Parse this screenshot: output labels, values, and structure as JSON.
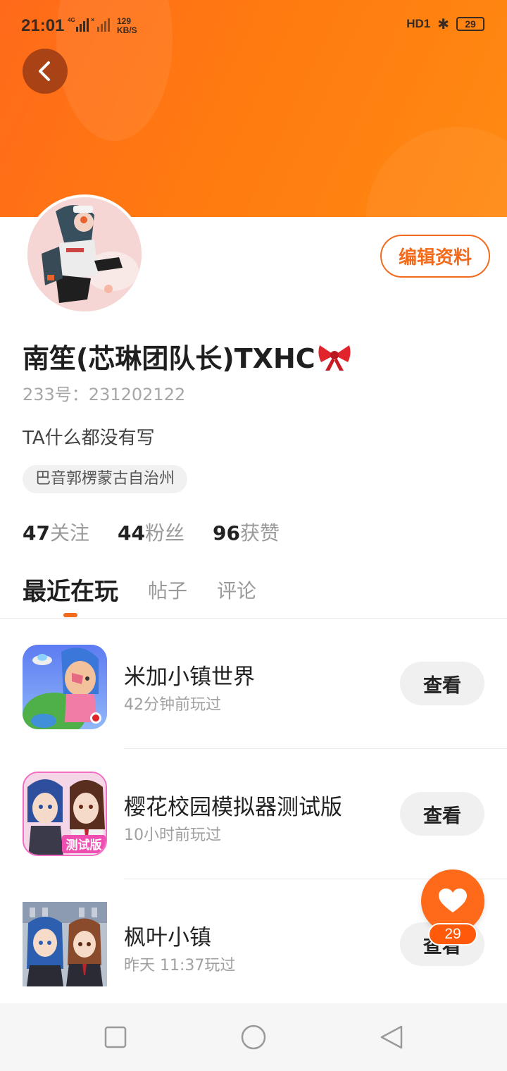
{
  "status_bar": {
    "time": "21:01",
    "network_top": "129",
    "network_bottom": "KB/S",
    "hd_label": "HD1",
    "bluetooth": "✱",
    "battery": "29"
  },
  "profile": {
    "edit_button": "编辑资料",
    "nickname": "南笙(芯琳团队长)TXHC",
    "uid": "233号：231202122",
    "bio": "TA什么都没有写",
    "location": "巴音郭楞蒙古自治州",
    "stats": [
      {
        "number": "47",
        "label": "关注"
      },
      {
        "number": "44",
        "label": "粉丝"
      },
      {
        "number": "96",
        "label": "获赞"
      }
    ]
  },
  "tabs": [
    {
      "label": "最近在玩",
      "active": true
    },
    {
      "label": "帖子",
      "active": false
    },
    {
      "label": "评论",
      "active": false
    }
  ],
  "games": [
    {
      "name": "米加小镇世界",
      "time": "42分钟前玩过",
      "button": "查看",
      "icon": "toca-world-icon"
    },
    {
      "name": "樱花校园模拟器测试版",
      "time": "10小时前玩过",
      "button": "查看",
      "icon": "sakura-school-icon",
      "icon_badge": "测试版"
    },
    {
      "name": "枫叶小镇",
      "time": "昨天 11:37玩过",
      "button": "查看",
      "icon": "maple-town-icon"
    }
  ],
  "favorite": {
    "count": "29"
  },
  "colors": {
    "accent": "#f26b1d",
    "banner": "#ff7a10"
  }
}
